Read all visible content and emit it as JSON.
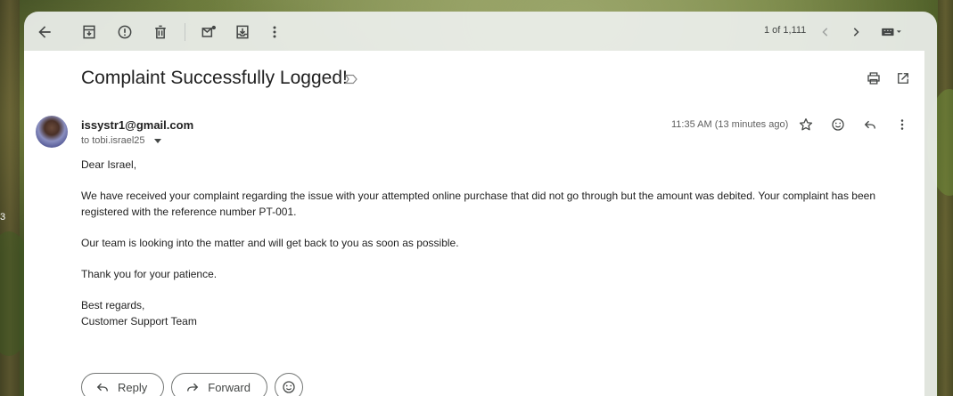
{
  "toolbar": {
    "icons": [
      "back-arrow-icon",
      "archive-icon",
      "report-spam-icon",
      "delete-icon",
      "mark-unread-icon",
      "move-to-icon",
      "more-vert-icon"
    ],
    "pager_text": "1 of 1,111",
    "input_tools": "keyboard-icon"
  },
  "background": {
    "edge_text": "3"
  },
  "email": {
    "subject": "Complaint Successfully Logged!",
    "sender": "issystr1@gmail.com",
    "recipient": "to tobi.israel25",
    "timestamp": "11:35 AM (13 minutes ago)",
    "body": [
      "Dear Israel,",
      "We have received your complaint regarding the issue with your attempted online purchase that did not go through but the amount was debited. Your complaint has been registered with the reference number PT-001.",
      "Our team is looking into the matter and will get back to you as soon as possible.",
      "Thank you for your patience.",
      "Best regards,",
      "Customer Support Team"
    ]
  },
  "actions": {
    "reply": "Reply",
    "forward": "Forward"
  }
}
